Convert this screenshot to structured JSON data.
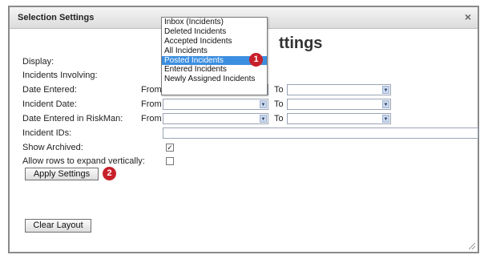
{
  "dialog": {
    "title": "Selection Settings",
    "close_glyph": "×",
    "heading_partial": "ttings"
  },
  "labels": {
    "display": "Display:",
    "incidents_involving": "Incidents Involving:",
    "date_entered": "Date Entered:",
    "incident_date": "Incident Date:",
    "date_entered_riskman": "Date Entered in RiskMan:",
    "incident_ids": "Incident IDs:",
    "show_archived": "Show Archived:",
    "allow_rows": "Allow rows to expand vertically:"
  },
  "range": {
    "from": "From",
    "to": "To"
  },
  "checks": {
    "show_archived": "✓",
    "allow_rows": ""
  },
  "buttons": {
    "apply": "Apply Settings",
    "clear": "Clear Layout"
  },
  "badges": {
    "one": "1",
    "two": "2"
  },
  "display_options": [
    "Inbox (Incidents)",
    "Deleted Incidents",
    "Accepted Incidents",
    "All Incidents",
    "Posted Incidents",
    "Entered Incidents",
    "Newly Assigned Incidents"
  ],
  "selected_display_option": "Posted Incidents",
  "colors": {
    "selection": "#3b8ee0",
    "badge": "#c8202a"
  },
  "icons": {
    "dropdown_arrow": "▼",
    "close": "close-icon",
    "resize": "resize-grip-icon"
  }
}
